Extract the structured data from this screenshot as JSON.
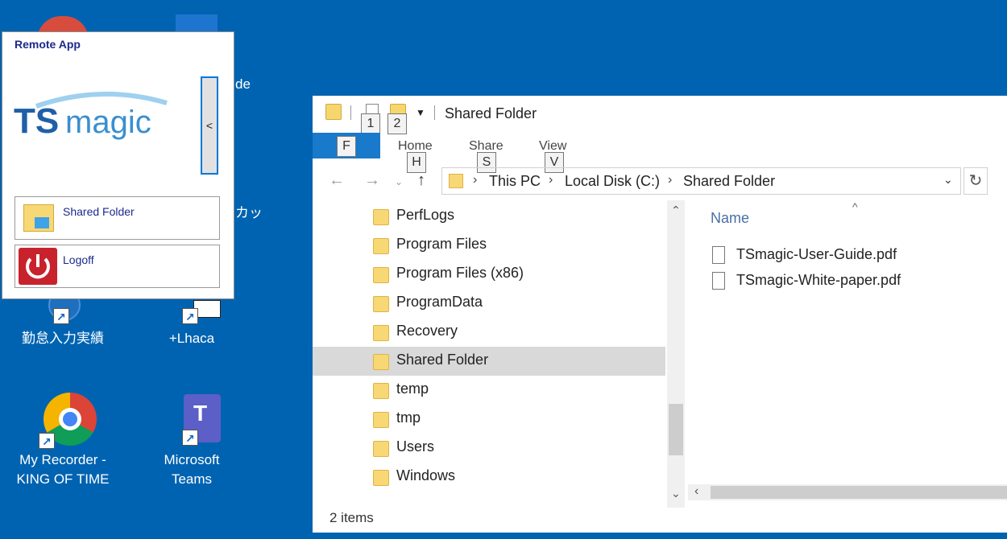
{
  "desktop": {
    "icons": [
      {
        "label_line1": "勤怠入力実績",
        "label_line2": ""
      },
      {
        "label_line1": "+Lhaca",
        "label_line2": ""
      },
      {
        "label_line1": "My Recorder -",
        "label_line2": "KING OF TIME"
      },
      {
        "label_line1": "Microsoft Teams",
        "label_line2": ""
      }
    ],
    "partial_texts": {
      "de": "de",
      "kana": "カッ"
    }
  },
  "remote_app": {
    "title": "Remote App",
    "logo_text": "TSmagic",
    "collapse_label": "<",
    "buttons": [
      {
        "label": "Shared Folder",
        "icon": "folder-icon"
      },
      {
        "label": "Logoff",
        "icon": "power-icon"
      }
    ]
  },
  "explorer": {
    "title": "Shared Folder",
    "keytips": {
      "qat1": "1",
      "qat2": "2",
      "file": "F",
      "home": "H",
      "share": "S",
      "view": "V"
    },
    "ribbon_tabs": [
      "Home",
      "Share",
      "View"
    ],
    "breadcrumb": [
      "This PC",
      "Local Disk (C:)",
      "Shared Folder"
    ],
    "nav_items": [
      "PerfLogs",
      "Program Files",
      "Program Files (x86)",
      "ProgramData",
      "Recovery",
      "Shared Folder",
      "temp",
      "tmp",
      "Users",
      "Windows"
    ],
    "selected_nav": "Shared Folder",
    "column_header": "Name",
    "files": [
      "TSmagic-User-Guide.pdf",
      "TSmagic-White-paper.pdf"
    ],
    "status": "2 items",
    "colors": {
      "accent": "#1979ca",
      "desktop": "#0063b1",
      "selection": "#d9d9d9"
    }
  }
}
